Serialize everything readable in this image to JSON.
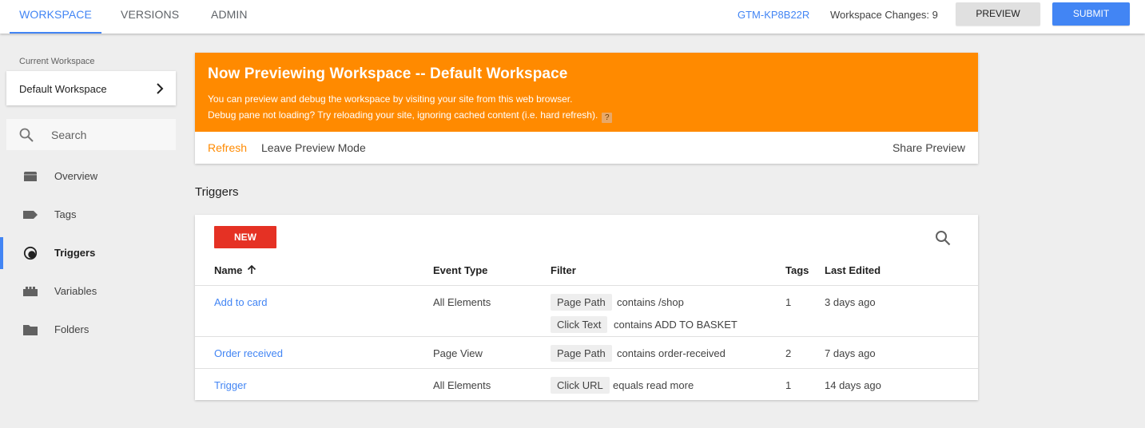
{
  "topbar": {
    "tabs": [
      {
        "label": "WORKSPACE"
      },
      {
        "label": "VERSIONS"
      },
      {
        "label": "ADMIN"
      }
    ],
    "container_id": "GTM-KP8B22R",
    "workspace_changes": "Workspace Changes: 9",
    "preview_label": "PREVIEW",
    "submit_label": "SUBMIT"
  },
  "sidebar": {
    "current_workspace_label": "Current Workspace",
    "workspace_name": "Default Workspace",
    "search_placeholder": "Search",
    "items": [
      {
        "label": "Overview",
        "icon": "overview-icon"
      },
      {
        "label": "Tags",
        "icon": "tag-icon"
      },
      {
        "label": "Triggers",
        "icon": "trigger-icon"
      },
      {
        "label": "Variables",
        "icon": "variables-icon"
      },
      {
        "label": "Folders",
        "icon": "folder-icon"
      }
    ]
  },
  "preview": {
    "title": "Now Previewing Workspace -- Default Workspace",
    "line1": "You can preview and debug the workspace by visiting your site from this web browser.",
    "line2": "Debug pane not loading? Try reloading your site, ignoring cached content (i.e. hard refresh).",
    "help": "?",
    "refresh": "Refresh",
    "leave": "Leave Preview Mode",
    "share": "Share Preview"
  },
  "triggers": {
    "section_title": "Triggers",
    "new_label": "NEW",
    "columns": {
      "name": "Name",
      "event_type": "Event Type",
      "filter": "Filter",
      "tags": "Tags",
      "last_edited": "Last Edited"
    },
    "rows": [
      {
        "name": "Add to card",
        "event_type": "All Elements",
        "filters": [
          {
            "variable": "Page Path",
            "condition": "contains /shop"
          },
          {
            "variable": "Click Text",
            "condition": "contains ADD TO BASKET"
          }
        ],
        "tags": "1",
        "last_edited": "3 days ago"
      },
      {
        "name": "Order received",
        "event_type": "Page View",
        "filters": [
          {
            "variable": "Page Path",
            "condition": "contains order-received"
          }
        ],
        "tags": "2",
        "last_edited": "7 days ago"
      },
      {
        "name": "Trigger",
        "event_type": "All Elements",
        "filters": [
          {
            "variable": "Click URL",
            "condition": "equals read more"
          }
        ],
        "tags": "1",
        "last_edited": "14 days ago"
      }
    ]
  },
  "colors": {
    "accent": "#4285f4",
    "preview_banner": "#ff8a00",
    "new_button": "#e53124"
  }
}
